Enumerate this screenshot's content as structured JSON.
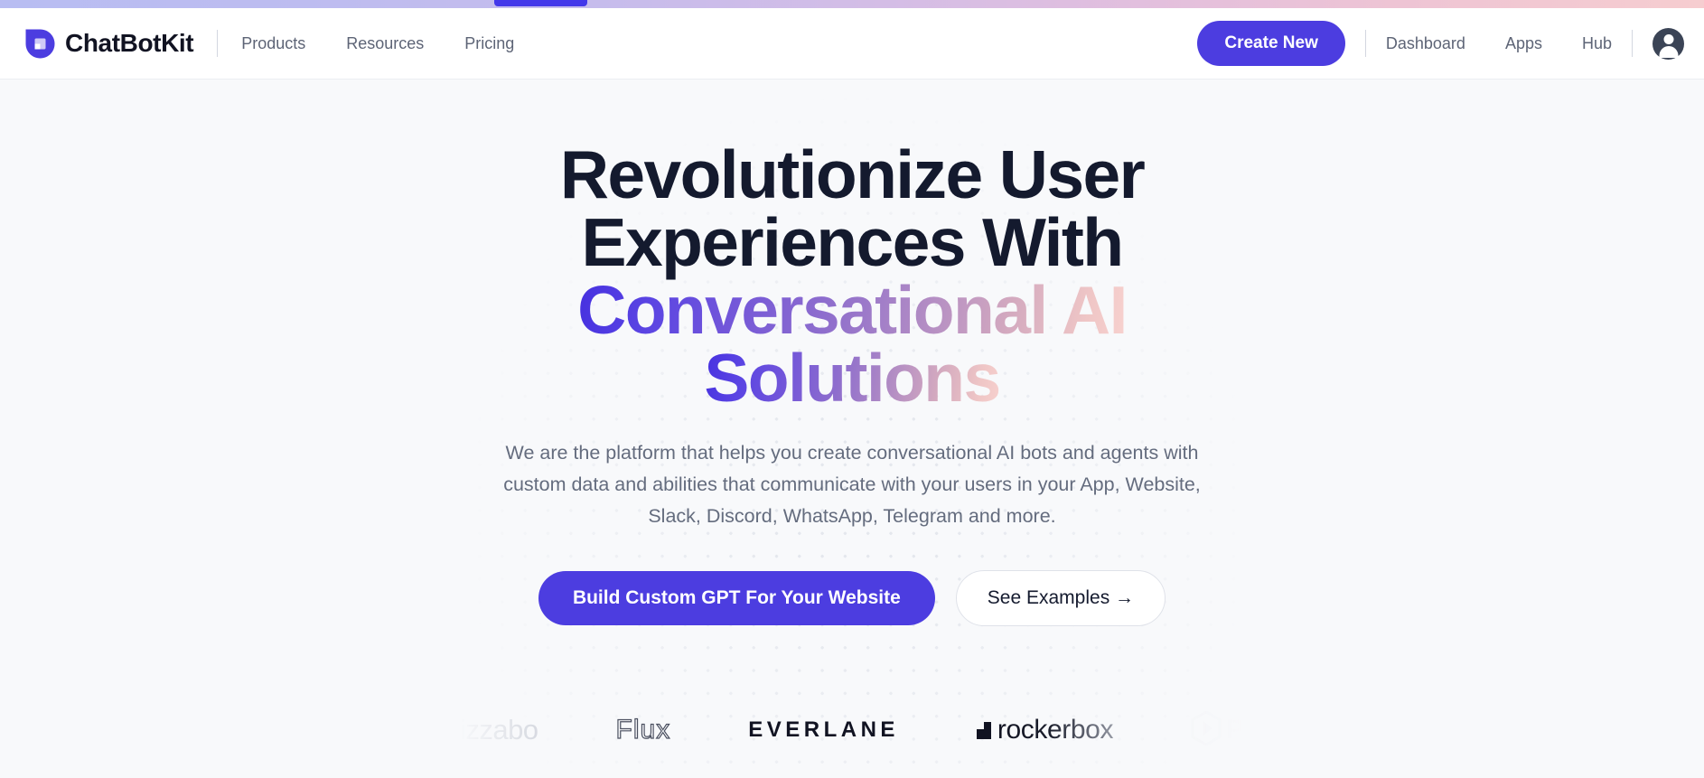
{
  "topbar": {
    "gradient_from": "#b8bdf2",
    "gradient_to": "#f6cdd0",
    "tab_color": "#4338ea"
  },
  "nav": {
    "brand": "ChatBotKit",
    "brand_icon": "chatbotkit-droplet-logo",
    "links": [
      {
        "label": "Products"
      },
      {
        "label": "Resources"
      },
      {
        "label": "Pricing"
      }
    ],
    "cta": {
      "label": "Create New",
      "color": "#4c3de0"
    },
    "links_right": [
      {
        "label": "Dashboard"
      },
      {
        "label": "Apps"
      },
      {
        "label": "Hub"
      }
    ],
    "avatar_icon": "user-avatar-icon"
  },
  "hero": {
    "headline_line1": "Revolutionize User",
    "headline_line2": "Experiences With",
    "headline_accent_line1": "Conversational AI",
    "headline_accent_line2": "Solutions",
    "headline_color": "#141a2e",
    "accent_gradient_from": "#4530e0",
    "accent_gradient_to": "#f8d2cf",
    "subtitle": "We are the platform that helps you create conversational AI bots and agents with custom data and abilities that communicate with your users in your App, Website, Slack, Discord, WhatsApp, Telegram and more.",
    "primary_cta": "Build Custom GPT For Your Website",
    "secondary_cta": "See Examples →"
  },
  "logos": [
    {
      "name": "bizzabo",
      "label": "izzabo"
    },
    {
      "name": "flux",
      "label": "Flux"
    },
    {
      "name": "everlane",
      "label": "EVERLANE"
    },
    {
      "name": "rockerbox",
      "label": "rockerbox"
    },
    {
      "name": "pendo",
      "label": "P"
    }
  ]
}
